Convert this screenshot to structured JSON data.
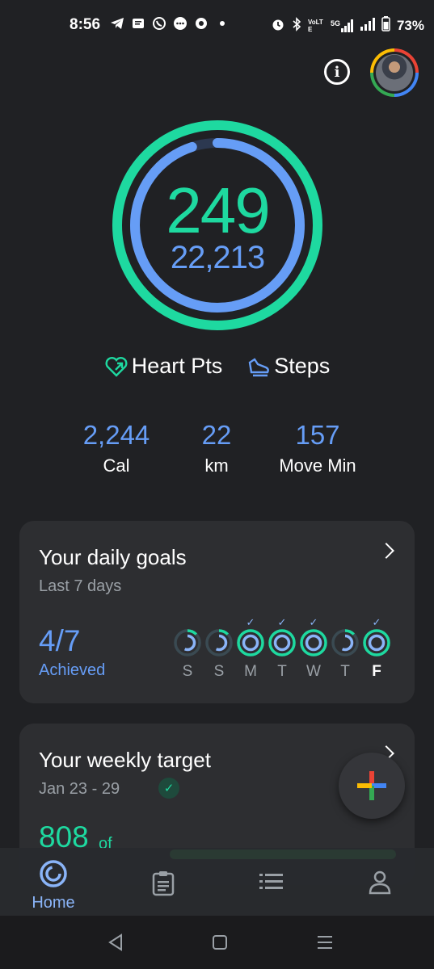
{
  "status_bar": {
    "time": "8:56",
    "battery": "73%",
    "net_label": "5G",
    "lte_label": "VoLTE"
  },
  "header": {
    "info_icon": "info-icon",
    "avatar_icon": "profile-avatar"
  },
  "rings": {
    "heart_pts": "249",
    "steps": "22,213",
    "heart_color": "#1ed9a0",
    "steps_color": "#669df6",
    "heart_progress": 1.0,
    "steps_progress": 0.95
  },
  "legend": {
    "heart_label": "Heart Pts",
    "steps_label": "Steps"
  },
  "stats": [
    {
      "value": "2,244",
      "label": "Cal"
    },
    {
      "value": "22",
      "label": "km"
    },
    {
      "value": "157",
      "label": "Move Min"
    }
  ],
  "daily_goals": {
    "title": "Your daily goals",
    "subtitle": "Last 7 days",
    "achieved_value": "4/7",
    "achieved_label": "Achieved",
    "days": [
      {
        "label": "S",
        "check": "",
        "achieved": false,
        "today": false
      },
      {
        "label": "S",
        "check": "",
        "achieved": false,
        "today": false
      },
      {
        "label": "M",
        "check": "✓",
        "achieved": true,
        "today": false
      },
      {
        "label": "T",
        "check": "✓",
        "achieved": true,
        "today": false
      },
      {
        "label": "W",
        "check": "✓",
        "achieved": true,
        "today": false
      },
      {
        "label": "T",
        "check": "",
        "achieved": false,
        "today": false
      },
      {
        "label": "F",
        "check": "✓",
        "achieved": true,
        "today": true
      }
    ]
  },
  "weekly_target": {
    "title": "Your weekly target",
    "date_range": "Jan 23 - 29",
    "value": "808",
    "of_label": "of"
  },
  "bottom_nav": {
    "home_label": "Home"
  }
}
